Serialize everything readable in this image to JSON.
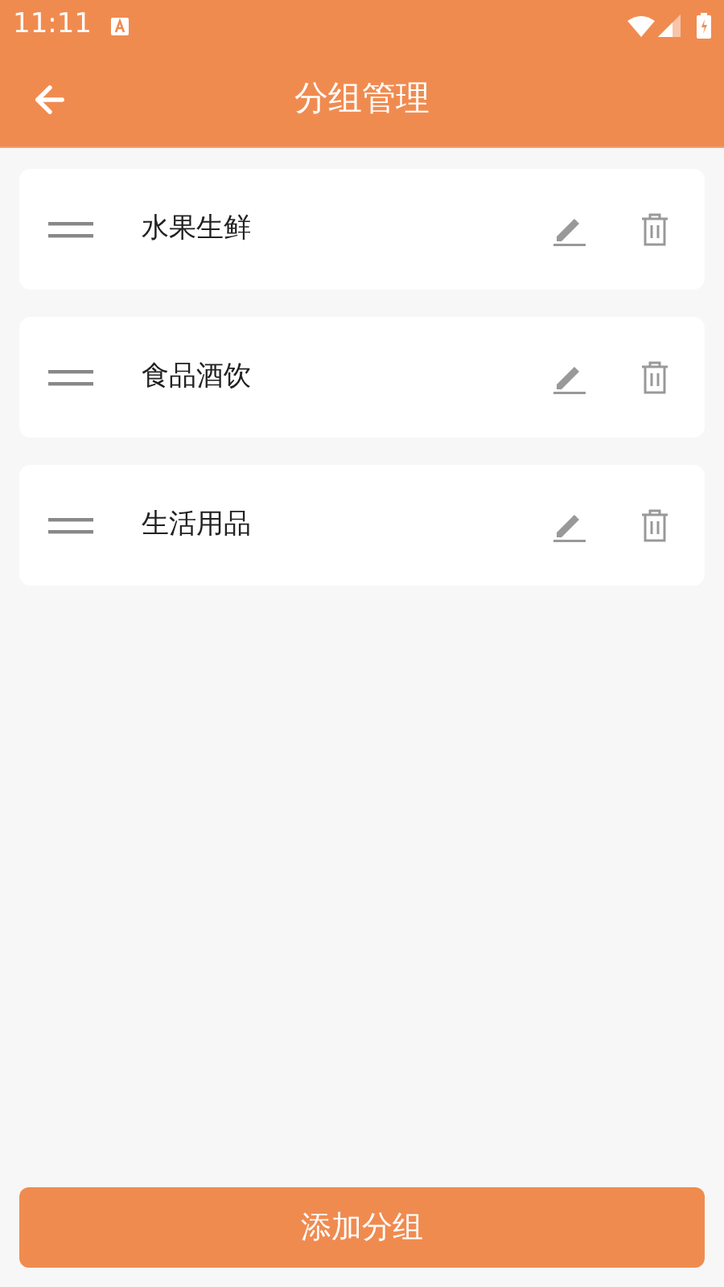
{
  "status_bar": {
    "time": "11:11"
  },
  "header": {
    "title": "分组管理"
  },
  "groups": [
    {
      "name": "水果生鲜"
    },
    {
      "name": "食品酒饮"
    },
    {
      "name": "生活用品"
    }
  ],
  "add_button": {
    "label": "添加分组"
  }
}
